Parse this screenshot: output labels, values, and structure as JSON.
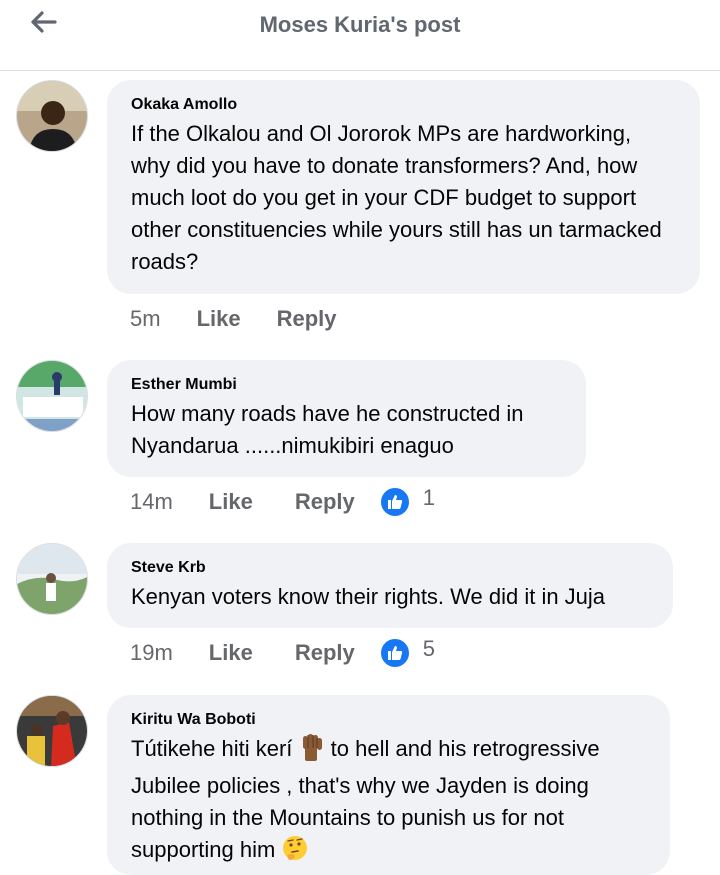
{
  "header": {
    "title": "Moses Kuria's post"
  },
  "comments": [
    {
      "author": "Okaka Amollo",
      "text": "If the Olkalou and Ol Jororok MPs are hardworking, why did you have to donate transformers? And, how much loot do you get in your CDF budget to support other constituencies while yours still has un tarmacked roads?",
      "time": "5m",
      "like_label": "Like",
      "reply_label": "Reply"
    },
    {
      "author": "Esther Mumbi",
      "text": "How many roads have he constructed in Nyandarua ......nimukibiri enaguo",
      "time": "14m",
      "like_label": "Like",
      "reply_label": "Reply",
      "reaction_count": "1"
    },
    {
      "author": "Steve Krb",
      "text": "Kenyan voters know their rights. We did it in Juja",
      "time": "19m",
      "like_label": "Like",
      "reply_label": "Reply",
      "reaction_count": "5"
    },
    {
      "author": "Kiritu Wa Boboti",
      "text_part1": "Tútikehe hiti kerí",
      "text_part2": " to hell and his retrogressive Jubilee policies , that's why we Jayden is doing nothing in the Mountains to punish us for not supporting him"
    }
  ],
  "colors": {
    "accent": "#1877f2",
    "bubble": "#f0f2f5",
    "muted": "#65676b",
    "title": "#606770"
  },
  "icons": {
    "back": "arrow-left-icon",
    "reaction": "thumbs-up-icon",
    "emoji1": "raised-fist-emoji",
    "emoji2": "thinking-face-emoji"
  }
}
